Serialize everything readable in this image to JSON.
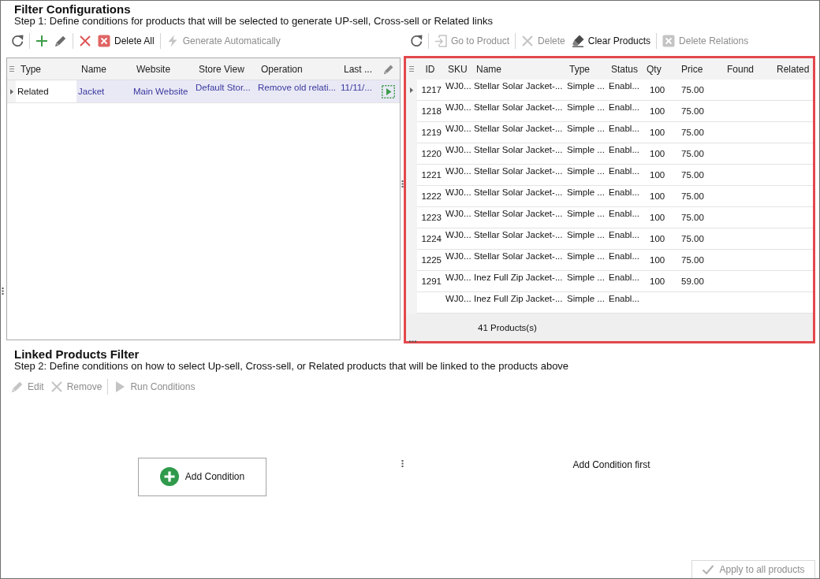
{
  "filter_configurations": {
    "title": "Filter Configurations",
    "description": "Step 1: Define conditions for products that will be selected to generate UP-sell, Cross-sell or Related links",
    "toolbar": [
      [
        {
          "kind": "refresh",
          "disabled": false
        }
      ],
      [
        {
          "kind": "add",
          "disabled": false
        },
        {
          "kind": "edit",
          "disabled": false
        }
      ],
      [
        {
          "kind": "delete",
          "disabled": false
        },
        {
          "kind": "delete_all",
          "label": "Delete All",
          "disabled": false
        }
      ],
      [
        {
          "kind": "generate",
          "label": "Generate Automatically",
          "disabled": true
        }
      ]
    ],
    "table": {
      "active": true,
      "columns": [
        "Type",
        "Name",
        "Website",
        "Store View",
        "Operation",
        "Last ..."
      ],
      "rows": [
        {
          "cells": [
            "Related",
            "Jacket",
            "Main Website",
            "Default Stor...",
            "Remove old relati...",
            "11/11/..."
          ],
          "selected": true
        }
      ]
    }
  },
  "products": {
    "toolbar": [
      [
        {
          "kind": "refresh",
          "disabled": false
        }
      ],
      [
        {
          "kind": "go_to",
          "label": "Go to Product",
          "disabled": true
        }
      ],
      [
        {
          "kind": "delete",
          "label": "Delete",
          "disabled": true
        },
        {
          "kind": "clear",
          "label": "Clear Products",
          "disabled": false
        }
      ],
      [
        {
          "kind": "delete_relations",
          "label": "Delete Relations",
          "disabled": true
        }
      ]
    ],
    "table": {
      "active": false,
      "columns": [
        "ID",
        "SKU",
        "Name",
        "Type",
        "Status",
        "Qty",
        "Price",
        "Found",
        "Related"
      ],
      "rows": [
        {
          "id": "1217",
          "sku": "WJ0...",
          "name": "Stellar Solar Jacket-...",
          "type": "Simple ...",
          "status": "Enabl...",
          "qty": "100",
          "price": "75.00",
          "selected": true
        },
        {
          "id": "1218",
          "sku": "WJ0...",
          "name": "Stellar Solar Jacket-...",
          "type": "Simple ...",
          "status": "Enabl...",
          "qty": "100",
          "price": "75.00",
          "selected": false
        },
        {
          "id": "1219",
          "sku": "WJ0...",
          "name": "Stellar Solar Jacket-...",
          "type": "Simple ...",
          "status": "Enabl...",
          "qty": "100",
          "price": "75.00",
          "selected": false
        },
        {
          "id": "1220",
          "sku": "WJ0...",
          "name": "Stellar Solar Jacket-...",
          "type": "Simple ...",
          "status": "Enabl...",
          "qty": "100",
          "price": "75.00",
          "selected": false
        },
        {
          "id": "1221",
          "sku": "WJ0...",
          "name": "Stellar Solar Jacket-...",
          "type": "Simple ...",
          "status": "Enabl...",
          "qty": "100",
          "price": "75.00",
          "selected": false
        },
        {
          "id": "1222",
          "sku": "WJ0...",
          "name": "Stellar Solar Jacket-...",
          "type": "Simple ...",
          "status": "Enabl...",
          "qty": "100",
          "price": "75.00",
          "selected": false
        },
        {
          "id": "1223",
          "sku": "WJ0...",
          "name": "Stellar Solar Jacket-...",
          "type": "Simple ...",
          "status": "Enabl...",
          "qty": "100",
          "price": "75.00",
          "selected": false
        },
        {
          "id": "1224",
          "sku": "WJ0...",
          "name": "Stellar Solar Jacket-...",
          "type": "Simple ...",
          "status": "Enabl...",
          "qty": "100",
          "price": "75.00",
          "selected": false
        },
        {
          "id": "1225",
          "sku": "WJ0...",
          "name": "Stellar Solar Jacket-...",
          "type": "Simple ...",
          "status": "Enabl...",
          "qty": "100",
          "price": "75.00",
          "selected": false
        },
        {
          "id": "1291",
          "sku": "WJ0...",
          "name": "Inez Full Zip Jacket-...",
          "type": "Simple ...",
          "status": "Enabl...",
          "qty": "100",
          "price": "59.00",
          "selected": false
        },
        {
          "sku": "WJ0...",
          "name": "Inez Full Zip Jacket-...",
          "type": "Simple ...",
          "status": "Enabl...",
          "selected": false
        }
      ],
      "footer": "41 Products(s)"
    }
  },
  "linked_products_filter": {
    "title": "Linked Products Filter",
    "description": "Step 2: Define conditions on how to select Up-sell, Cross-sell, or Related products that will be linked to the products above",
    "toolbar": [
      [
        {
          "kind": "edit",
          "label": "Edit",
          "disabled": true
        },
        {
          "kind": "remove",
          "label": "Remove",
          "disabled": true
        }
      ],
      [
        {
          "kind": "run",
          "label": "Run Conditions",
          "disabled": true
        }
      ]
    ],
    "add_button": {
      "label": "Add Condition"
    },
    "message": "Add Condition first",
    "apply_button": {
      "label": "Apply to all products",
      "disabled": true
    }
  }
}
